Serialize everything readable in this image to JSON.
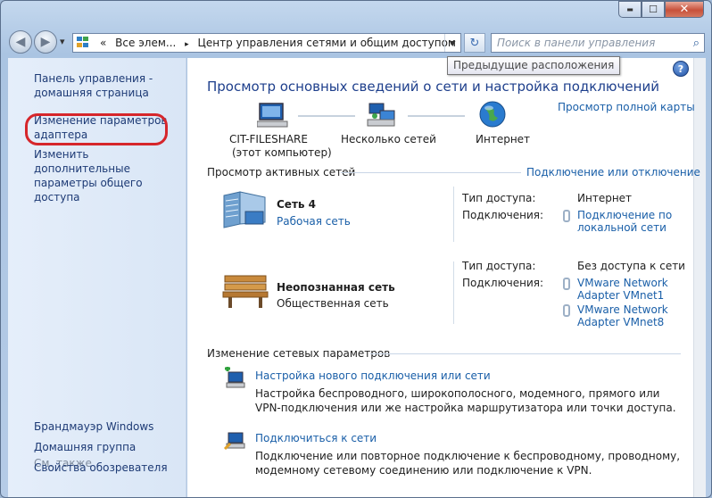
{
  "window": {
    "caption": {
      "min": "▬",
      "max": "☐",
      "close": "✕"
    }
  },
  "nav": {
    "back": "◀",
    "forward": "▶",
    "history": "▾",
    "address": {
      "prefix": "«",
      "crumb1": "Все элем...",
      "separator": "▸",
      "crumb2": "Центр управления сетями и общим доступом",
      "dropdown": "▼"
    },
    "refresh": "↻",
    "search_placeholder": "Поиск в панели управления",
    "search_icon": "⌕",
    "tooltip": "Предыдущие расположения"
  },
  "sidebar": {
    "home": "Панель управления - домашняя страница",
    "adapter": "Изменение параметров адаптера",
    "sharing": "Изменить дополнительные параметры общего доступа",
    "see_also": "См. также",
    "links": [
      "Брандмауэр Windows",
      "Домашняя группа",
      "Свойства обозревателя"
    ]
  },
  "main": {
    "help": "?",
    "title": "Просмотр основных сведений о сети и настройка подключений",
    "full_map": "Просмотр полной карты",
    "map": {
      "computer_name": "CIT-FILESHARE",
      "computer_sub": "(этот компьютер)",
      "multiple": "Несколько сетей",
      "internet": "Интернет"
    },
    "active_header": "Просмотр активных сетей",
    "connect_disconnect": "Подключение или отключение",
    "networks": [
      {
        "name": "Сеть  4",
        "type": "Рабочая сеть",
        "access_label": "Тип доступа:",
        "access_value": "Интернет",
        "conn_label": "Подключения:",
        "conn_1": "Подключение по",
        "conn_2": "локальной сети"
      },
      {
        "name": "Неопознанная сеть",
        "type": "Общественная сеть",
        "access_label": "Тип доступа:",
        "access_value": "Без доступа к сети",
        "conn_label": "Подключения:",
        "conn_a1": "VMware Network",
        "conn_a2": "Adapter VMnet1",
        "conn_b1": "VMware Network",
        "conn_b2": "Adapter VMnet8"
      }
    ],
    "change_header": "Изменение сетевых параметров",
    "tasks": [
      {
        "link": "Настройка нового подключения или сети",
        "desc1": "Настройка беспроводного, широкополосного, модемного, прямого или",
        "desc2": "VPN-подключения или же настройка маршрутизатора или точки доступа."
      },
      {
        "link": "Подключиться к сети",
        "desc1": "Подключение или повторное подключение к беспроводному, проводному,",
        "desc2": "модемному сетевому соединению или подключение к VPN."
      }
    ]
  }
}
